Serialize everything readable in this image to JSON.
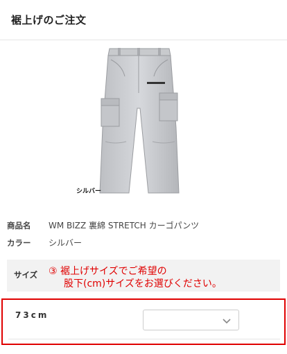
{
  "header": {
    "title": "裾上げのご注文"
  },
  "product": {
    "image_alt": "cargo-pants-photo",
    "color_tag": "シルバー"
  },
  "specs": {
    "name_label": "商品名",
    "name_value": "WM BIZZ 裏綿 STRETCH カーゴパンツ",
    "color_label": "カラー",
    "color_value": "シルバー"
  },
  "size": {
    "label": "サイズ",
    "note_line1": "③ 裾上げサイズでご希望の",
    "note_line2": "股下(cm)サイズをお選びください。",
    "length_label": "73cm",
    "select_value": ""
  },
  "colors": {
    "accent_red": "#e00000",
    "band_gray": "#f2f2f2"
  },
  "icons": {
    "select": "chevron-down-icon"
  }
}
